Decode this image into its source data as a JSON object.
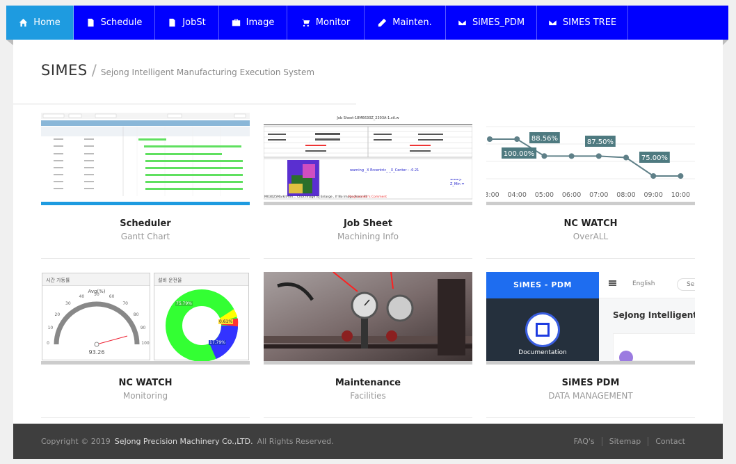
{
  "nav": {
    "items": [
      {
        "label": "Home",
        "icon": "home-icon"
      },
      {
        "label": "Schedule",
        "icon": "document-icon"
      },
      {
        "label": "JobSt",
        "icon": "document-icon"
      },
      {
        "label": "Image",
        "icon": "briefcase-icon"
      },
      {
        "label": "Monitor",
        "icon": "cart-icon"
      },
      {
        "label": "Mainten.",
        "icon": "pencil-icon"
      },
      {
        "label": "SiMES_PDM",
        "icon": "envelope-icon"
      },
      {
        "label": "SIMES TREE",
        "icon": "envelope-icon"
      }
    ],
    "active": "Home",
    "bg_color": "#0000ff",
    "active_color": "#1e9be0"
  },
  "header": {
    "title": "SIMES",
    "separator": "/",
    "subtitle": "Sejong Intelligent Manufacturing Execution System"
  },
  "cards": [
    {
      "title": "Scheduler",
      "subtitle": "Gantt Chart"
    },
    {
      "title": "Job Sheet",
      "subtitle": "Machining Info"
    },
    {
      "title": "NC WATCH",
      "subtitle": "OverALL"
    },
    {
      "title": "NC WATCH",
      "subtitle": "Monitoring"
    },
    {
      "title": "Maintenance",
      "subtitle": "Facilities"
    },
    {
      "title": "SiMES PDM",
      "subtitle": "DATA MANAGEMENT"
    }
  ],
  "jobsheet": {
    "title": "Job Sheet-18M6630Z_2303A-1.stl.w",
    "warning": "warning _X Eccentric_ _X_Center : -0.21",
    "footer_left": "M03025MarkIt-hm... Click Image to Enlarge , If No Image Press F5",
    "footer_right": "Programmer's Comment",
    "arrow": "===> Z_Min ="
  },
  "overall_chart": {
    "x_labels": [
      "3:00",
      "04:00",
      "05:00",
      "06:00",
      "07:00",
      "08:00",
      "09:00",
      "10:00"
    ],
    "values": [
      100,
      100,
      88.56,
      88.5,
      88.5,
      87.5,
      75.0,
      75.0
    ],
    "labels": [
      "100.00%",
      "88.56%",
      "87.50%",
      "75.00%"
    ]
  },
  "monitoring": {
    "left_title": "시간 가동률",
    "gauge_title": "Avg(%)",
    "gauge_value": "93.26",
    "gauge_ticks": [
      "0",
      "10",
      "20",
      "30",
      "40",
      "50",
      "60",
      "70",
      "80",
      "90",
      "100"
    ],
    "right_title": "설비 운전율",
    "donut_labels": [
      "75.79%",
      "0.61%",
      "17.79%"
    ],
    "donut_colors": [
      "#33ff33",
      "#ffff00",
      "#ff3333",
      "#3333ff"
    ]
  },
  "pdm": {
    "brand": "SiMES - PDM",
    "language": "English",
    "search": "Se",
    "heading": "SeJong Intelligent",
    "doc_label": "Documentation"
  },
  "footer": {
    "copyright": "Copyright © 2019",
    "company": "SeJong Precision Machinery Co.,LTD.",
    "rights": "All Rights Reserved.",
    "links": [
      "FAQ's",
      "Sitemap",
      "Contact"
    ]
  }
}
